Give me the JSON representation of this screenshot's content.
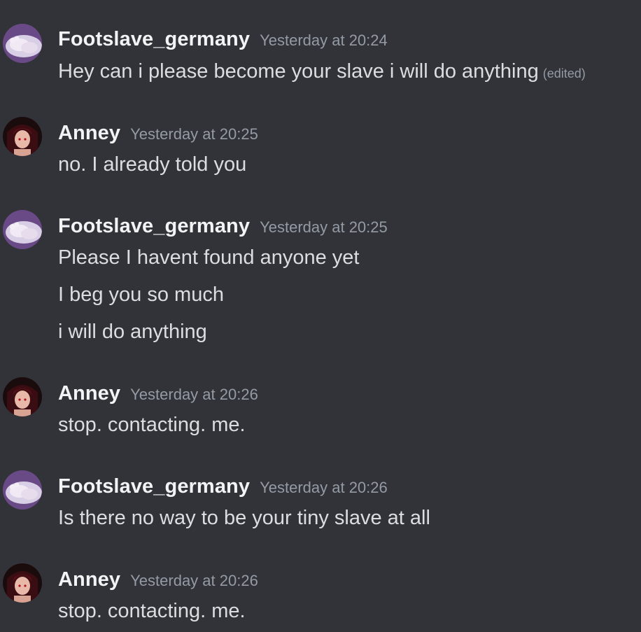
{
  "colors": {
    "background": "#313338",
    "username": "#f2f3f5",
    "message_text": "#dbdee1",
    "timestamp": "#949ba4"
  },
  "messages": [
    {
      "author": "Footslave_germany",
      "avatar_icon": "feet-photo-avatar-icon",
      "timestamp": "Yesterday at 20:24",
      "lines": [
        "Hey can i please become your slave i will do anything"
      ],
      "edited_label": "(edited)"
    },
    {
      "author": "Anney",
      "avatar_icon": "anime-girl-avatar-icon",
      "timestamp": "Yesterday at 20:25",
      "lines": [
        "no. I already told you"
      ]
    },
    {
      "author": "Footslave_germany",
      "avatar_icon": "feet-photo-avatar-icon",
      "timestamp": "Yesterday at 20:25",
      "lines": [
        "Please I havent found anyone yet",
        "I beg you so much",
        "i will do anything"
      ]
    },
    {
      "author": "Anney",
      "avatar_icon": "anime-girl-avatar-icon",
      "timestamp": "Yesterday at 20:26",
      "lines": [
        "stop. contacting. me."
      ]
    },
    {
      "author": "Footslave_germany",
      "avatar_icon": "feet-photo-avatar-icon",
      "timestamp": "Yesterday at 20:26",
      "lines": [
        "Is there no way to be your tiny slave at all"
      ]
    },
    {
      "author": "Anney",
      "avatar_icon": "anime-girl-avatar-icon",
      "timestamp": "Yesterday at 20:26",
      "lines": [
        "stop. contacting. me."
      ]
    }
  ]
}
